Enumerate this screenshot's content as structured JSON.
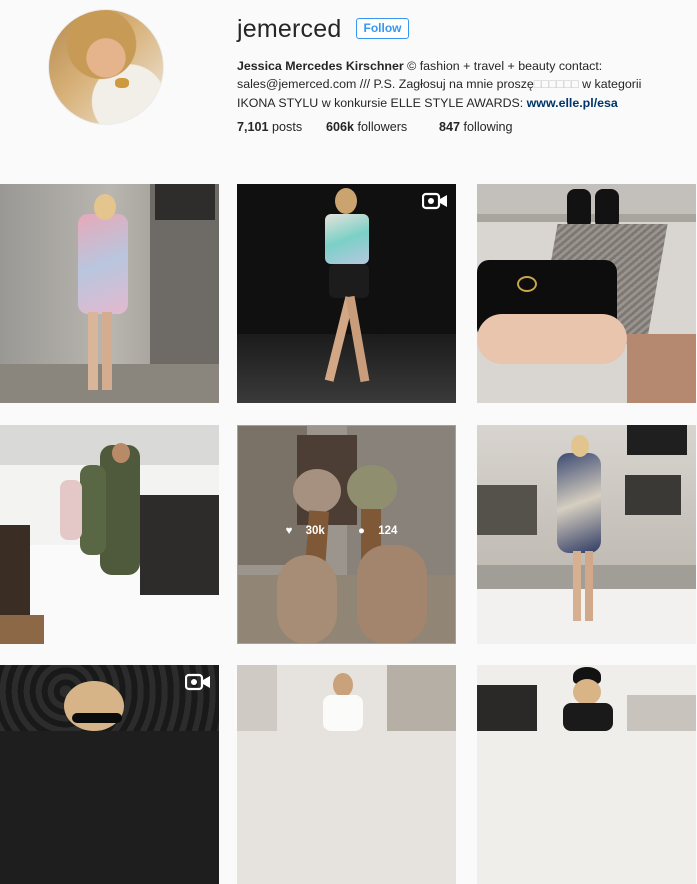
{
  "profile": {
    "username": "jemerced",
    "follow_label": "Follow",
    "full_name": "Jessica Mercedes Kirschner",
    "bio_part1": " © fashion + travel + beauty contact: sales@jemerced.com /// P.S. Zagłosuj na mnie proszę",
    "bio_boxes": "□□□□□□",
    "bio_part2": " w kategorii IKONA STYLU w konkursie ELLE STYLE AWARDS: ",
    "bio_link": "www.elle.pl/esa",
    "posts_count": "7,101",
    "posts_label": "posts",
    "followers_count": "606k",
    "followers_label": "followers",
    "following_count": "847",
    "following_label": "following"
  },
  "grid": {
    "hover_likes": "30k",
    "hover_comments": "124"
  },
  "colors": {
    "accent": "#3897f0",
    "link": "#003569"
  }
}
